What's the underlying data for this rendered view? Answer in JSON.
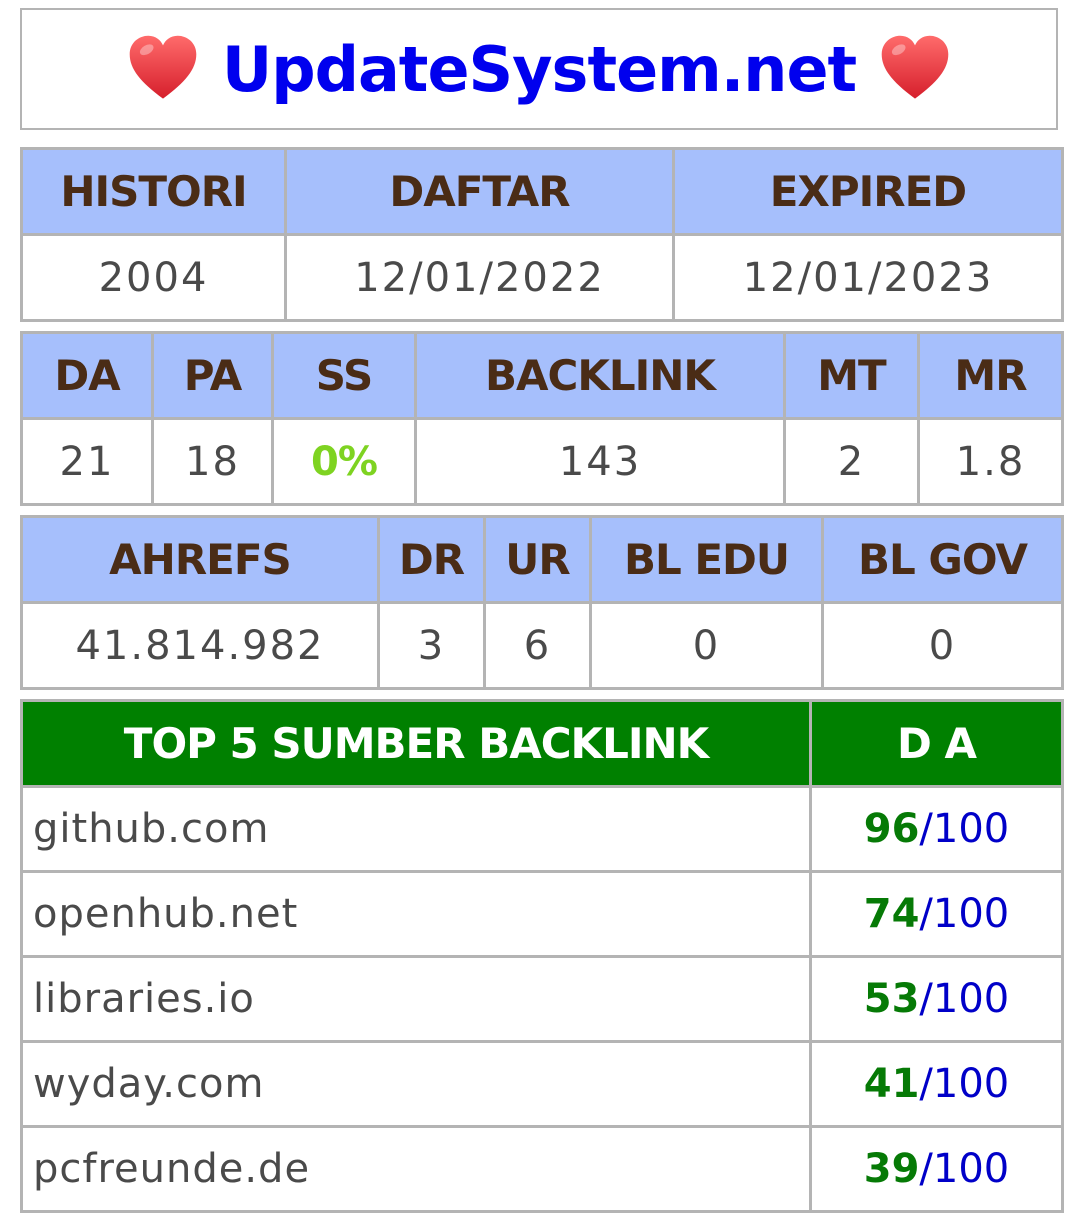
{
  "header": {
    "title": "UpdateSystem.net",
    "left_icon": "heart-icon",
    "right_icon": "heart-icon",
    "title_color": "#0000ee",
    "heart_color": "#e8323c"
  },
  "dates": {
    "headers": [
      "HISTORI",
      "DAFTAR",
      "EXPIRED"
    ],
    "values": [
      "2004",
      "12/01/2022",
      "12/01/2023"
    ]
  },
  "metrics": {
    "headers": [
      "DA",
      "PA",
      "SS",
      "BACKLINK",
      "MT",
      "MR"
    ],
    "values": [
      "21",
      "18",
      "0%",
      "143",
      "2",
      "1.8"
    ],
    "ss_color": "#7ed321"
  },
  "ahrefs": {
    "headers": [
      "AHREFS",
      "DR",
      "UR",
      "BL EDU",
      "BL GOV"
    ],
    "values": [
      "41.814.982",
      "3",
      "6",
      "0",
      "0"
    ]
  },
  "backlinks": {
    "header_source": "TOP 5 SUMBER BACKLINK",
    "header_da": "D A",
    "header_color": "#008000",
    "rows": [
      {
        "site": "github.com",
        "da": "96",
        "max": "/100"
      },
      {
        "site": "openhub.net",
        "da": "74",
        "max": "/100"
      },
      {
        "site": "libraries.io",
        "da": "53",
        "max": "/100"
      },
      {
        "site": "wyday.com",
        "da": "41",
        "max": "/100"
      },
      {
        "site": "pcfreunde.de",
        "da": "39",
        "max": "/100"
      }
    ]
  },
  "colors": {
    "header_bg": "#a6bffc",
    "header_text": "#4a2c16",
    "border": "#b4b4b4"
  }
}
